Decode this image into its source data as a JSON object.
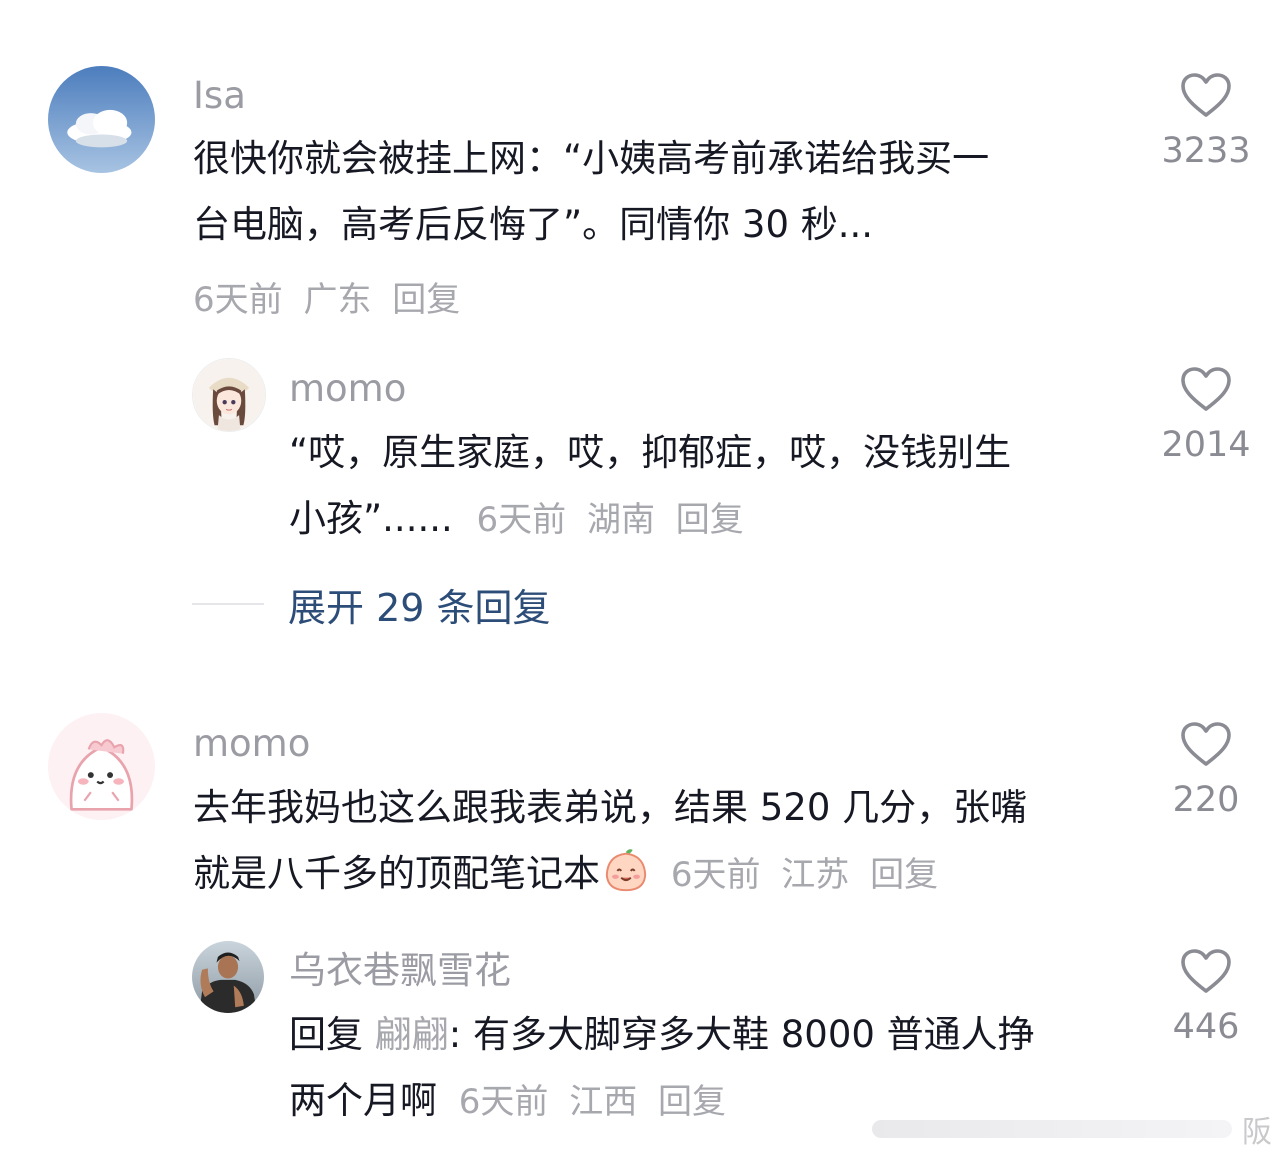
{
  "comments": [
    {
      "username": "Isa",
      "text_line1": "很快你就会被挂上网：“小姨高考前承诺给我买一",
      "text_line2": "台电脑，高考后反悔了”。同情你 30 秒...",
      "time": "6天前",
      "location": "广东",
      "reply_label": "回复",
      "likes": "3233",
      "avatar_icon": "sky-cloud-avatar"
    },
    {
      "username": "momo",
      "text_line1": "“哎，原生家庭，哎，抑郁症，哎，没钱别生",
      "text_line2": "小孩”......",
      "time": "6天前",
      "location": "湖南",
      "reply_label": "回复",
      "likes": "2014",
      "avatar_icon": "anime-girl-avatar"
    },
    {
      "username": "momo",
      "text_line1": "去年我妈也这么跟我表弟说，结果 520 几分，张嘴",
      "text_line2": "就是八千多的顶配笔记本",
      "time": "6天前",
      "location": "江苏",
      "reply_label": "回复",
      "likes": "220",
      "avatar_icon": "pink-blob-avatar",
      "emoji_icon": "smiling-peach-emoji"
    },
    {
      "username": "乌衣巷飘雪花",
      "reply_prefix": "回复",
      "mention": "翩翩",
      "text_line1_rest": ": 有多大脚穿多大鞋 8000 普通人挣",
      "text_line2": "两个月啊",
      "time": "6天前",
      "location": "江西",
      "reply_label": "回复",
      "likes": "446",
      "avatar_icon": "man-photo-avatar"
    }
  ],
  "expand_replies": "展开 29 条回复",
  "icons": {
    "like": "heart-outline-icon"
  },
  "colors": {
    "text": "#161823",
    "meta": "#a7a8ae",
    "link": "#2d4d79"
  },
  "watermark": "阪"
}
